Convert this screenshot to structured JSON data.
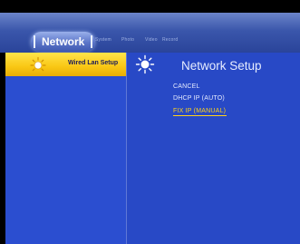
{
  "colors": {
    "accent_yellow": "#ffd21a",
    "panel_blue": "#2849c6",
    "topbar_blue": "#3a56ab"
  },
  "topbar": {
    "active_tab": "Network",
    "tabs": [
      "System",
      "Photo",
      "Video",
      "Record"
    ]
  },
  "sidebar": {
    "items": [
      {
        "label": "Wired Lan Setup",
        "icon": "sun-icon",
        "selected": true
      }
    ]
  },
  "main": {
    "title": "Network Setup",
    "icon": "sun-icon",
    "options": [
      {
        "label": "CANCEL",
        "selected": false
      },
      {
        "label": "DHCP IP (AUTO)",
        "selected": false
      },
      {
        "label": "FIX IP (MANUAL)",
        "selected": true
      }
    ]
  }
}
